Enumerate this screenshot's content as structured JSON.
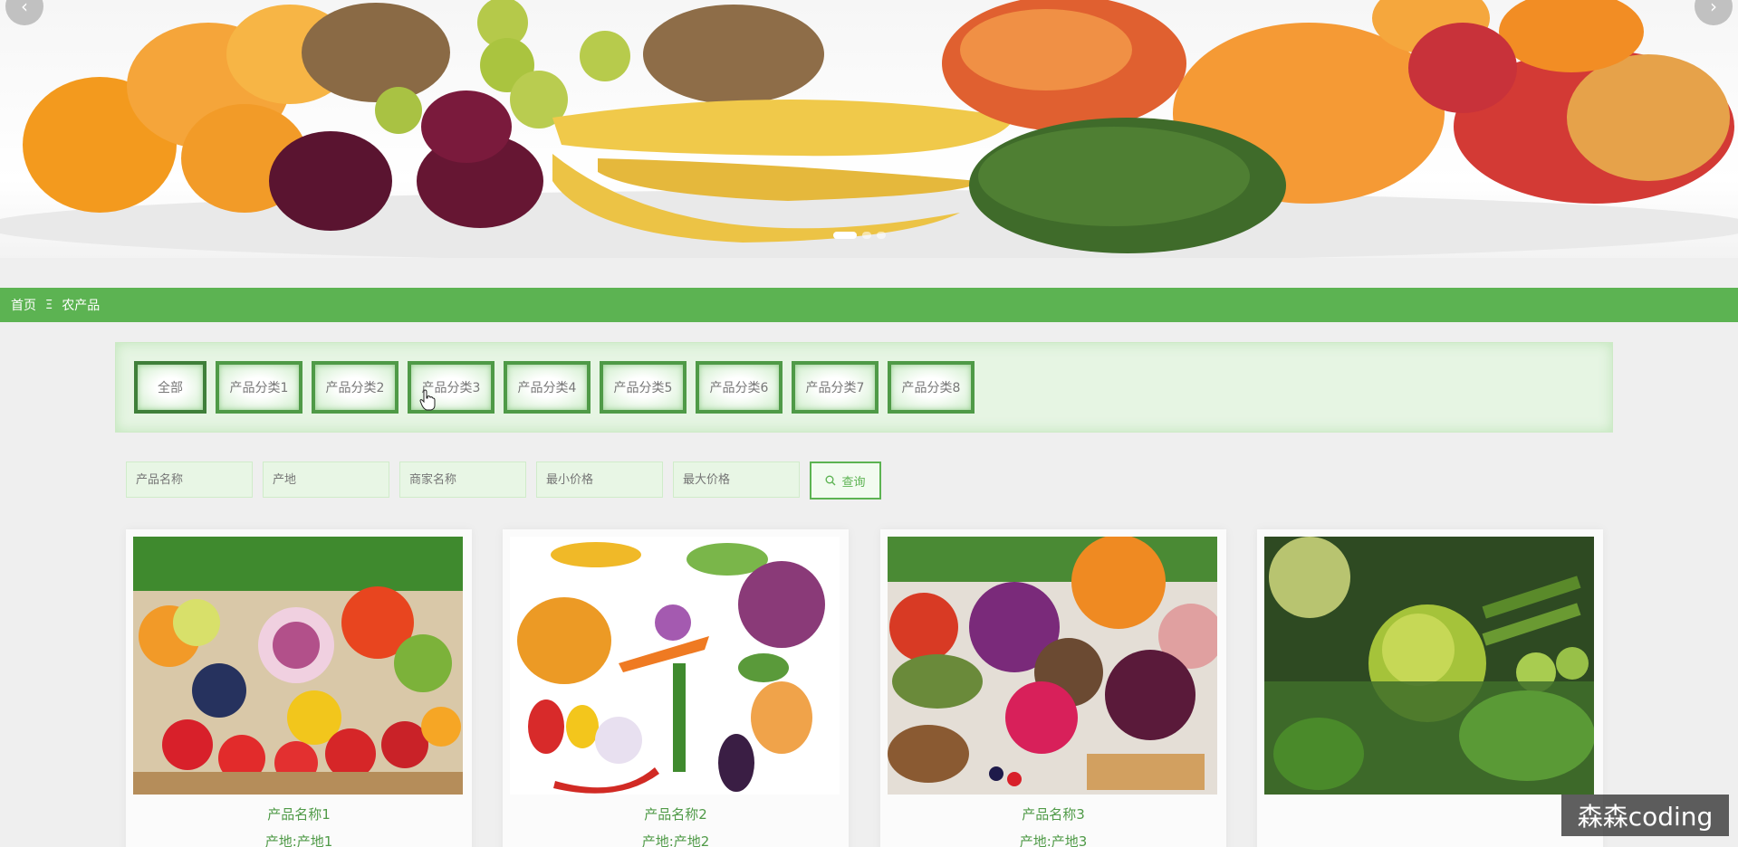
{
  "banner": {
    "prev_icon": "chevron-left-icon",
    "next_icon": "chevron-right-icon",
    "slide_count": 3,
    "active_slide": 1
  },
  "breadcrumb": {
    "home": "首页",
    "separator": "Ξ",
    "current": "农产品"
  },
  "categories": [
    "全部",
    "产品分类1",
    "产品分类2",
    "产品分类3",
    "产品分类4",
    "产品分类5",
    "产品分类6",
    "产品分类7",
    "产品分类8"
  ],
  "search": {
    "name_placeholder": "产品名称",
    "origin_placeholder": "产地",
    "merchant_placeholder": "商家名称",
    "min_price_placeholder": "最小价格",
    "max_price_placeholder": "最大价格",
    "button_label": "查询",
    "button_icon": "search-icon"
  },
  "products": [
    {
      "name": "产品名称1",
      "origin": "产地:产地1"
    },
    {
      "name": "产品名称2",
      "origin": "产地:产地2"
    },
    {
      "name": "产品名称3",
      "origin": "产地:产地3"
    },
    {
      "name": "",
      "origin": ""
    }
  ],
  "watermark": "森森coding",
  "colors": {
    "accent": "#5cb352",
    "accent_dark": "#4f9a47",
    "category_bg": "#e6f5e3",
    "page_bg": "#efefef"
  }
}
